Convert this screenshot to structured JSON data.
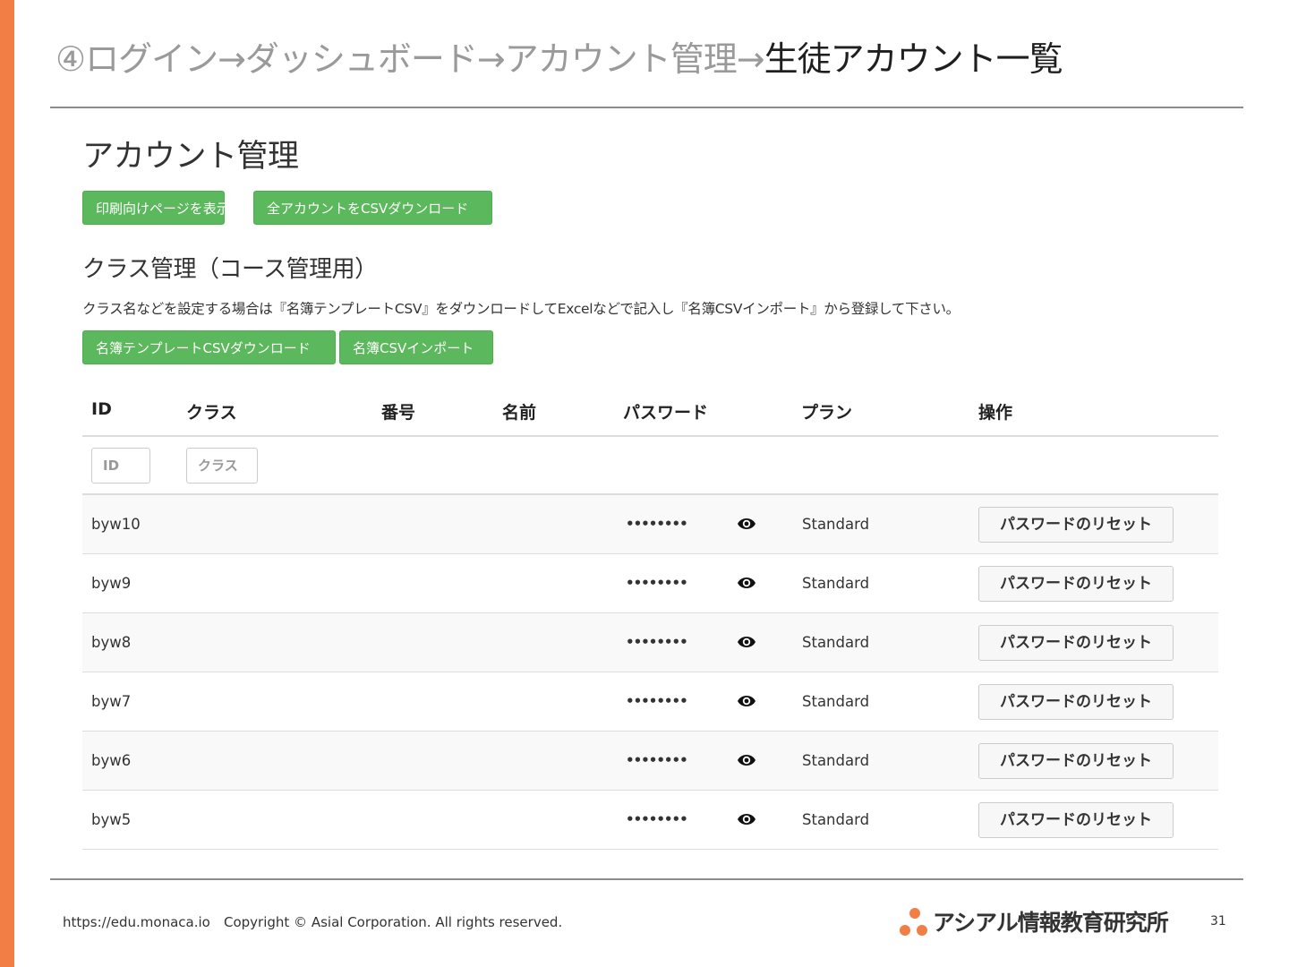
{
  "slide": {
    "title_path": "④ログイン→ダッシュボード→アカウント管理→",
    "title_current": "生徒アカウント一覧",
    "accent_color": "#f27e45"
  },
  "page": {
    "heading": "アカウント管理",
    "buttons": {
      "print": "印刷向けページを表示",
      "csv_all": "全アカウントをCSVダウンロード"
    }
  },
  "class_section": {
    "heading": "クラス管理（コース管理用）",
    "help": "クラス名などを設定する場合は『名簿テンプレートCSV』をダウンロードしてExcelなどで記入し『名簿CSVインポート』から登録して下さい。",
    "buttons": {
      "template_download": "名簿テンプレートCSVダウンロード",
      "csv_import": "名簿CSVインポート"
    },
    "button_color": "#5cb85c"
  },
  "table": {
    "headers": {
      "id": "ID",
      "class": "クラス",
      "number": "番号",
      "name": "名前",
      "password": "パスワード",
      "plan": "プラン",
      "actions": "操作"
    },
    "filters": {
      "id_placeholder": "ID",
      "class_placeholder": "クラス"
    },
    "rows": [
      {
        "id": "byw10",
        "class": "",
        "number": "",
        "name": "",
        "password": "••••••••",
        "plan": "Standard",
        "action": "パスワードのリセット"
      },
      {
        "id": "byw9",
        "class": "",
        "number": "",
        "name": "",
        "password": "••••••••",
        "plan": "Standard",
        "action": "パスワードのリセット"
      },
      {
        "id": "byw8",
        "class": "",
        "number": "",
        "name": "",
        "password": "••••••••",
        "plan": "Standard",
        "action": "パスワードのリセット"
      },
      {
        "id": "byw7",
        "class": "",
        "number": "",
        "name": "",
        "password": "••••••••",
        "plan": "Standard",
        "action": "パスワードのリセット"
      },
      {
        "id": "byw6",
        "class": "",
        "number": "",
        "name": "",
        "password": "••••••••",
        "plan": "Standard",
        "action": "パスワードのリセット"
      },
      {
        "id": "byw5",
        "class": "",
        "number": "",
        "name": "",
        "password": "••••••••",
        "plan": "Standard",
        "action": "パスワードのリセット"
      }
    ],
    "row_icon": "eye-icon"
  },
  "footer": {
    "url": "https://edu.monaca.io",
    "copyright": "Copyright © Asial Corporation. All rights reserved.",
    "logo_text": "アシアル情報教育研究所",
    "page_number": "31"
  }
}
